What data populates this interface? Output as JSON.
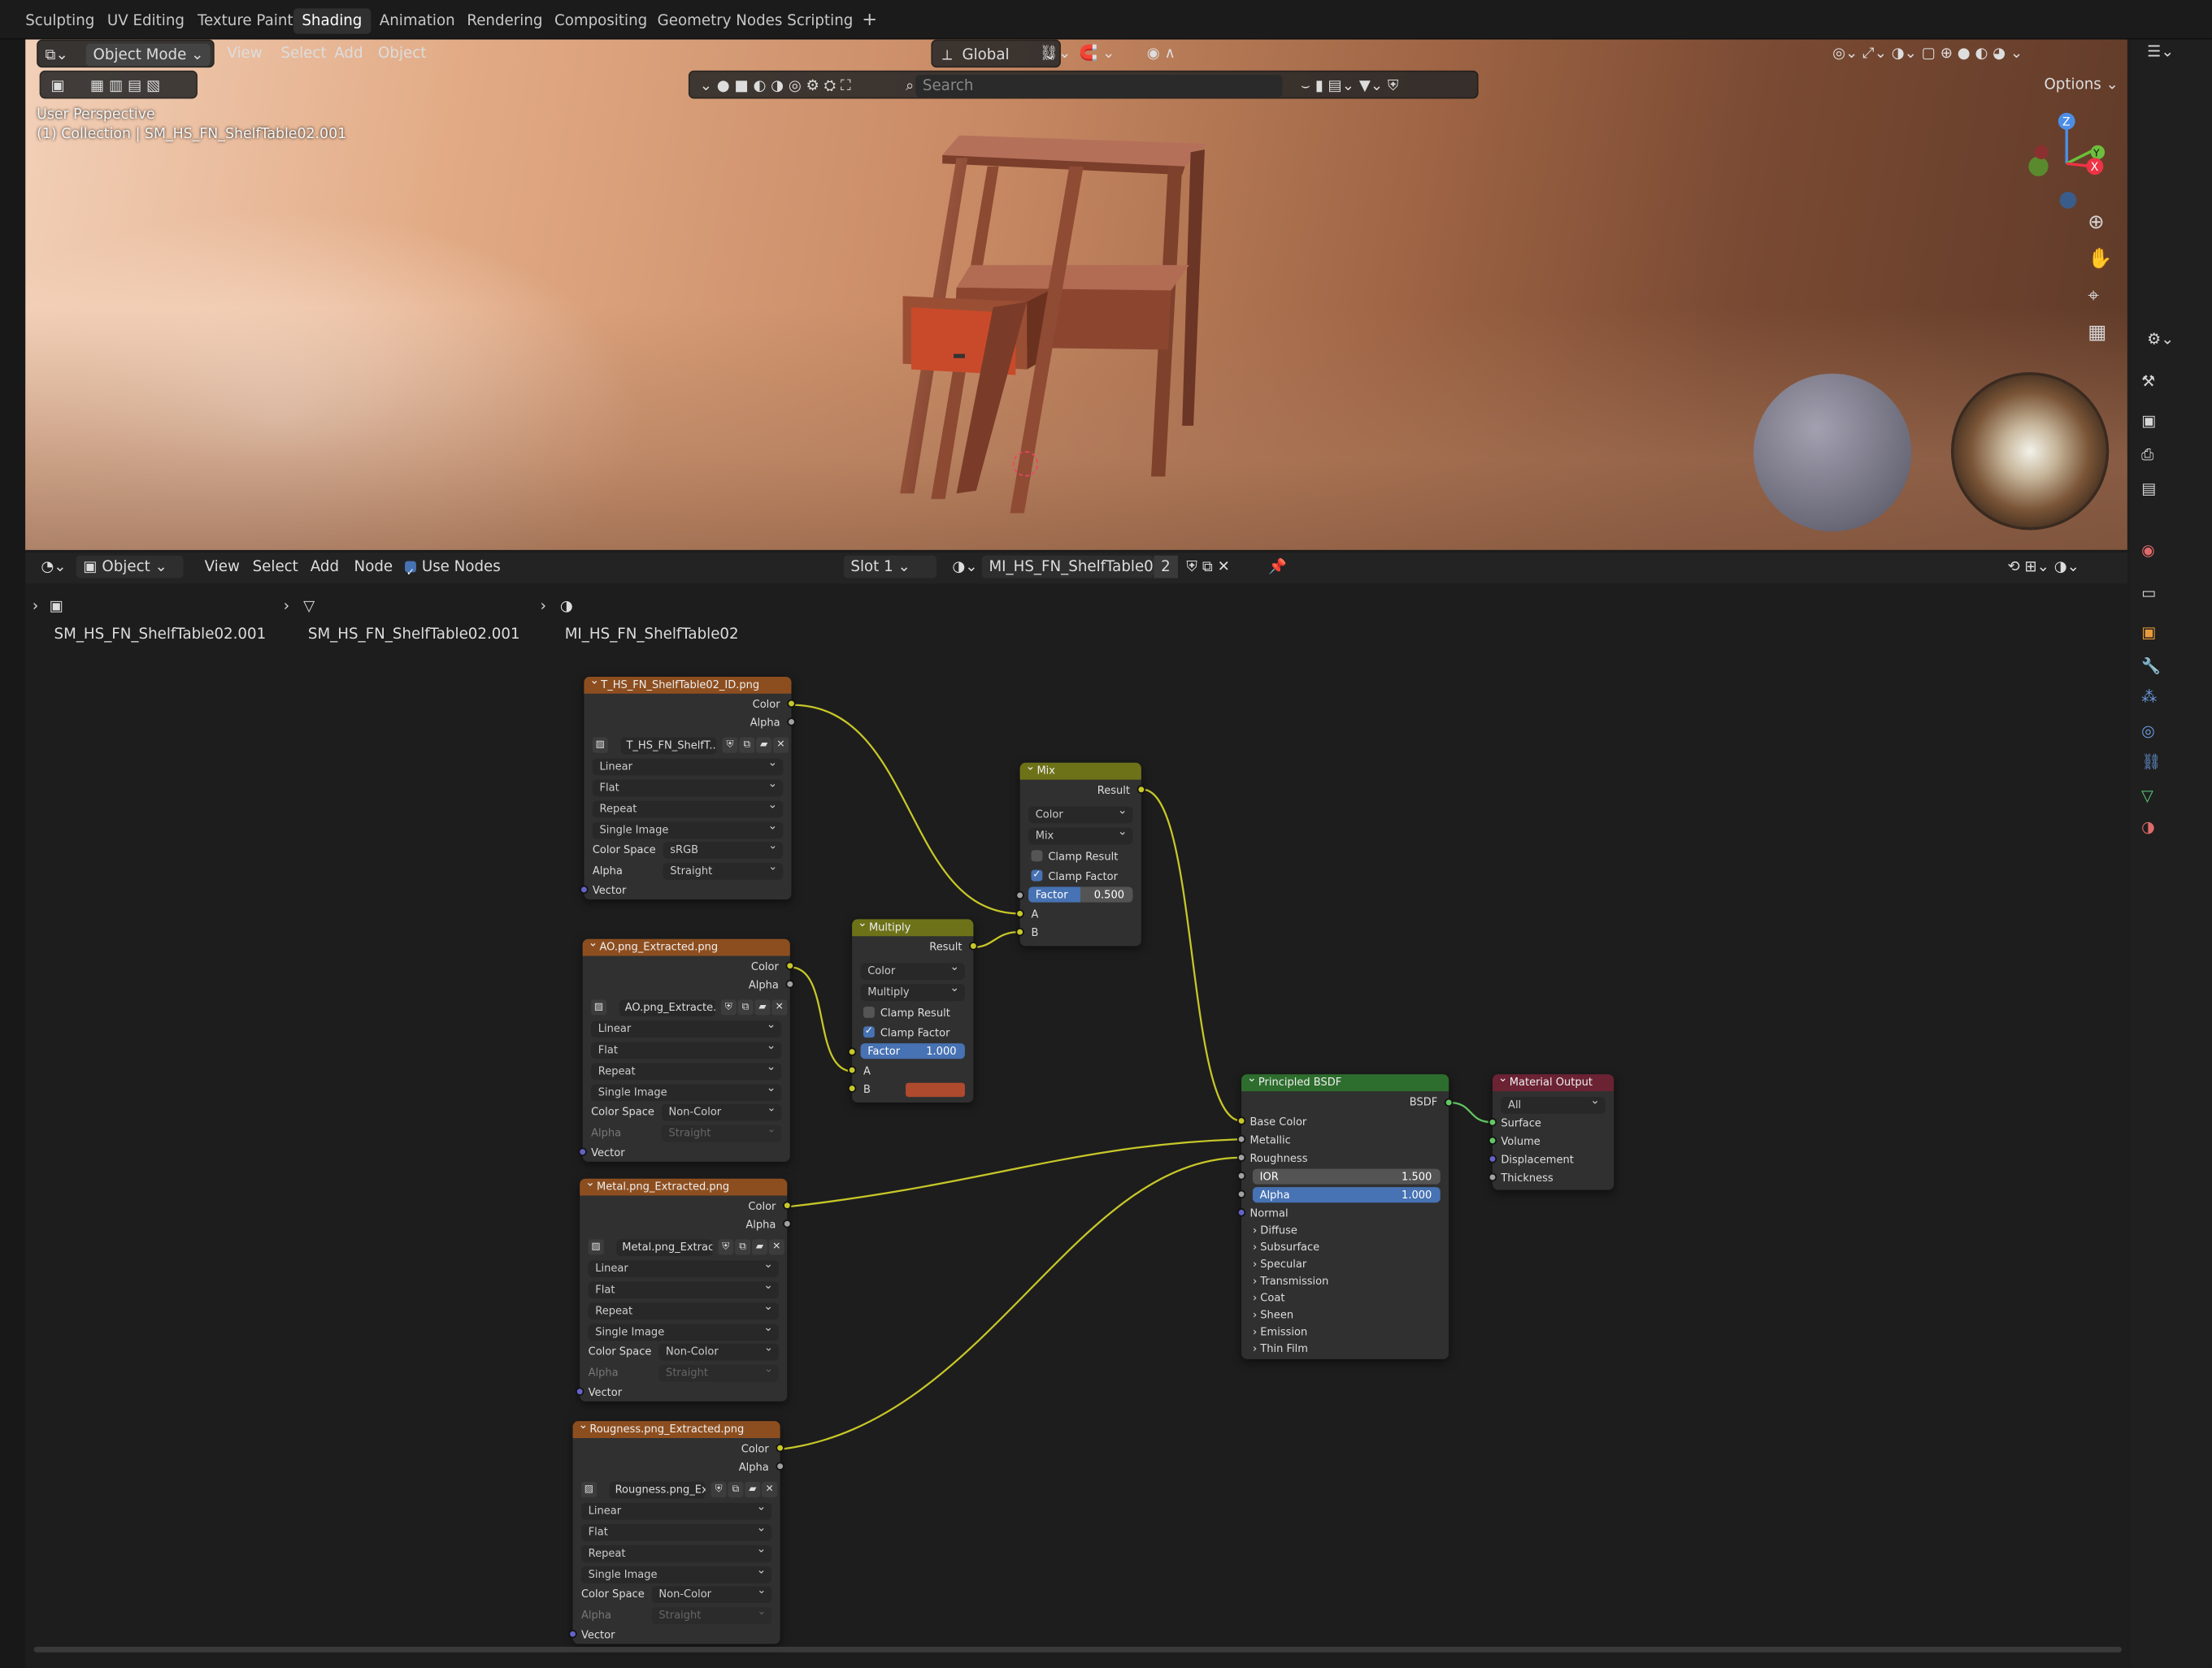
{
  "workspace_tabs": [
    "Sculpting",
    "UV Editing",
    "Texture Paint",
    "Shading",
    "Animation",
    "Rendering",
    "Compositing",
    "Geometry Nodes",
    "Scripting"
  ],
  "active_tab": "Shading",
  "viewport": {
    "mode": "Object Mode",
    "menus": [
      "View",
      "Select",
      "Add",
      "Object"
    ],
    "transform_orientation": "Global",
    "search_placeholder": "Search",
    "options_label": "Options",
    "overlay_line1": "User Perspective",
    "overlay_line2": "(1) Collection | SM_HS_FN_ShelfTable02.001",
    "gizmo_z": "Z",
    "gizmo_y": "Y"
  },
  "node_editor": {
    "object_selector": "Object",
    "menus": [
      "View",
      "Select",
      "Add",
      "Node"
    ],
    "use_nodes_label": "Use Nodes",
    "use_nodes_checked": true,
    "slot": "Slot 1",
    "material_name": "MI_HS_FN_ShelfTable02",
    "user_count": "2",
    "breadcrumb": [
      "SM_HS_FN_ShelfTable02.001",
      "SM_HS_FN_ShelfTable02.001",
      "MI_HS_FN_ShelfTable02"
    ]
  },
  "nodes": {
    "tex1": {
      "title": "T_HS_FN_ShelfTable02_ID.png",
      "image": "T_HS_FN_ShelfT...",
      "interp": "Linear",
      "proj": "Flat",
      "ext": "Repeat",
      "source": "Single Image",
      "cs_label": "Color Space",
      "cs": "sRGB",
      "alpha_label": "Alpha",
      "alpha": "Straight",
      "out_color": "Color",
      "out_alpha": "Alpha",
      "in_vector": "Vector"
    },
    "tex2": {
      "title": "AO.png_Extracted.png",
      "image": "AO.png_Extracte...",
      "interp": "Linear",
      "proj": "Flat",
      "ext": "Repeat",
      "source": "Single Image",
      "cs_label": "Color Space",
      "cs": "Non-Color",
      "alpha_label": "Alpha",
      "alpha": "Straight",
      "out_color": "Color",
      "out_alpha": "Alpha",
      "in_vector": "Vector"
    },
    "tex3": {
      "title": "Metal.png_Extracted.png",
      "image": "Metal.png_Extrac...",
      "interp": "Linear",
      "proj": "Flat",
      "ext": "Repeat",
      "source": "Single Image",
      "cs_label": "Color Space",
      "cs": "Non-Color",
      "alpha_label": "Alpha",
      "alpha": "Straight",
      "out_color": "Color",
      "out_alpha": "Alpha",
      "in_vector": "Vector"
    },
    "tex4": {
      "title": "Rougness.png_Extracted.png",
      "image": "Rougness.png_Ex...",
      "interp": "Linear",
      "proj": "Flat",
      "ext": "Repeat",
      "source": "Single Image",
      "cs_label": "Color Space",
      "cs": "Non-Color",
      "alpha_label": "Alpha",
      "alpha": "Straight",
      "out_color": "Color",
      "out_alpha": "Alpha",
      "in_vector": "Vector"
    },
    "mix": {
      "title": "Mix",
      "out": "Result",
      "data_type": "Color",
      "blend": "Mix",
      "clamp_result": "Clamp Result",
      "clamp_factor": "Clamp Factor",
      "factor_label": "Factor",
      "factor": "0.500",
      "in_a": "A",
      "in_b": "B"
    },
    "multiply": {
      "title": "Multiply",
      "out": "Result",
      "data_type": "Color",
      "blend": "Multiply",
      "clamp_result": "Clamp Result",
      "clamp_factor": "Clamp Factor",
      "factor_label": "Factor",
      "factor": "1.000",
      "in_a": "A",
      "in_b": "B",
      "b_color": "#b04a2e"
    },
    "bsdf": {
      "title": "Principled BSDF",
      "out": "BSDF",
      "base_color": "Base Color",
      "metallic": "Metallic",
      "roughness": "Roughness",
      "ior_label": "IOR",
      "ior": "1.500",
      "alpha_label": "Alpha",
      "alpha": "1.000",
      "normal": "Normal",
      "panels": [
        "Diffuse",
        "Subsurface",
        "Specular",
        "Transmission",
        "Coat",
        "Sheen",
        "Emission",
        "Thin Film"
      ]
    },
    "output": {
      "title": "Material Output",
      "target": "All",
      "surface": "Surface",
      "volume": "Volume",
      "displacement": "Displacement",
      "thickness": "Thickness"
    }
  },
  "colors": {
    "texture_header": "#8d4e1f",
    "mix_header": "#6d7219",
    "bsdf_header": "#2d6d2d",
    "output_header": "#6b2233",
    "color_socket": "#c7c729",
    "accent": "#4772b3"
  }
}
